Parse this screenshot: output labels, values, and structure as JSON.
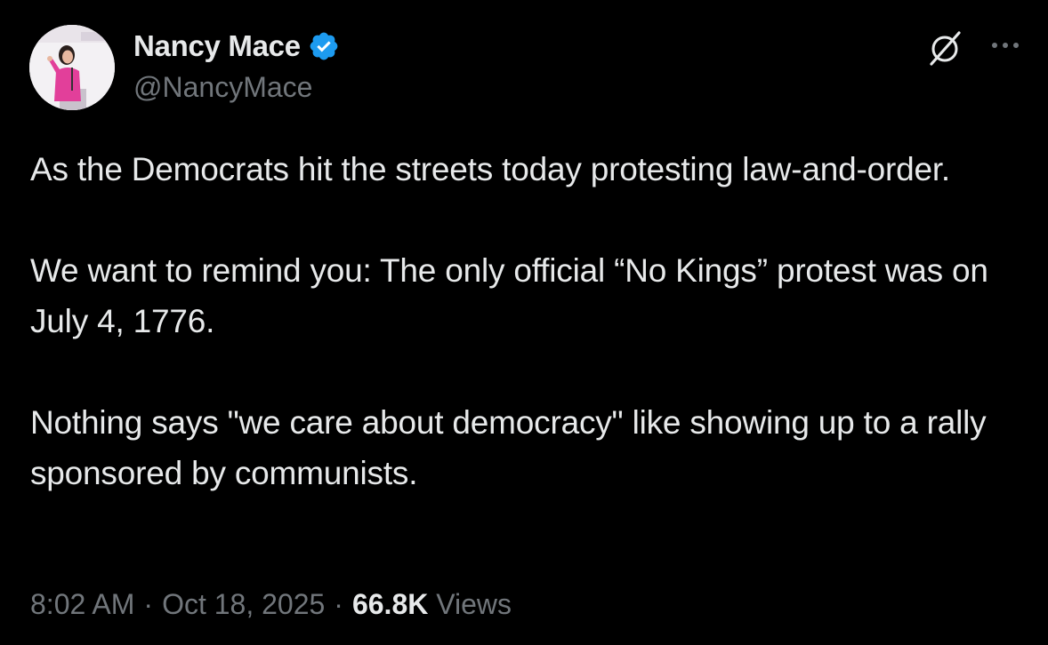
{
  "author": {
    "display_name": "Nancy Mace",
    "handle": "@NancyMace",
    "verified": true,
    "verified_color": "#1d9bf0"
  },
  "tweet": {
    "paragraphs": [
      "As the Democrats hit the streets today protesting law-and-order.",
      "We want to remind you: The only official “No Kings” protest was on July 4, 1776.",
      "Nothing says \"we care about democracy\" like showing up to a rally sponsored by communists."
    ]
  },
  "meta": {
    "time": "8:02 AM",
    "separator": "·",
    "date": "Oct 18, 2025",
    "views_count": "66.8K",
    "views_label": "Views"
  },
  "icons": {
    "grok": "grok-icon",
    "more": "more-horizontal-icon",
    "verified": "verified-badge-icon"
  },
  "colors": {
    "background": "#000000",
    "primary_text": "#e7e9ea",
    "secondary_text": "#71767b",
    "accent": "#1d9bf0"
  }
}
